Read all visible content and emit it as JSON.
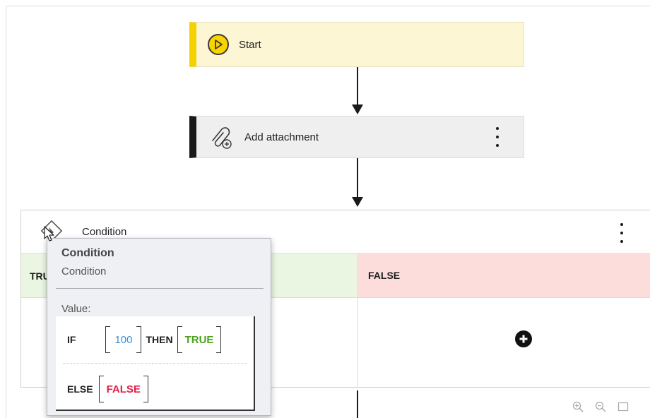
{
  "flow": {
    "start_label": "Start",
    "attachment_label": "Add attachment",
    "condition": {
      "title": "Condition",
      "true_label": "TRUE",
      "false_label": "FALSE"
    }
  },
  "tooltip": {
    "title": "Condition",
    "subtitle": "Condition",
    "value_label": "Value:",
    "expression": {
      "if_kw": "IF",
      "if_value": "100",
      "then_kw": "THEN",
      "then_value": "TRUE",
      "else_kw": "ELSE",
      "else_value": "FALSE"
    }
  },
  "colors": {
    "start_accent": "#f5d100",
    "true_branch": "#eaf5e2",
    "false_branch": "#fddcdc",
    "value_number": "#3a8fdc",
    "value_true": "#4aa31c",
    "value_false": "#e01e4a"
  },
  "icons": {
    "start": "play-circle-icon",
    "attachment": "paperclip-plus-icon",
    "condition": "diamond-condition-icon",
    "add": "plus-circle-icon",
    "zoom_in": "zoom-in-icon",
    "zoom_out": "zoom-out-icon",
    "fit": "fit-view-icon"
  }
}
